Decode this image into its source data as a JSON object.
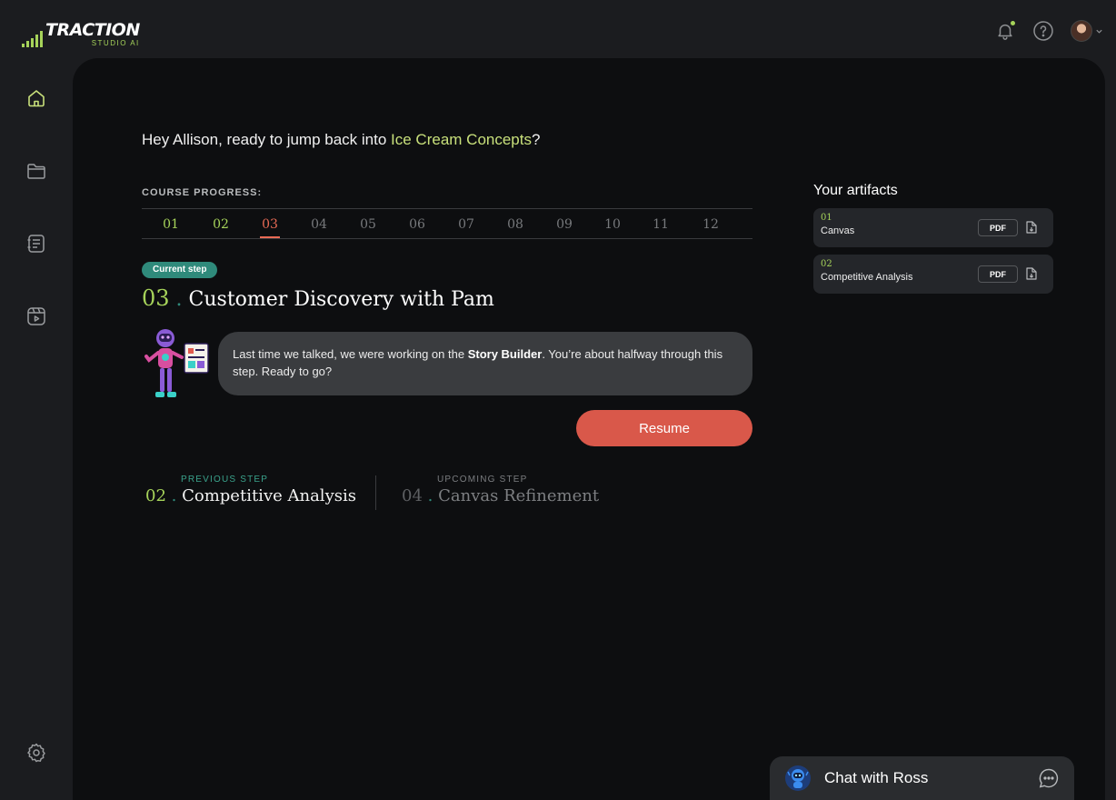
{
  "app": {
    "logo_main": "TRACTION",
    "logo_sub": "STUDIO AI",
    "accent_color": "#a6d35a",
    "brand_red": "#d9584a"
  },
  "topbar": {
    "icons": [
      "bell-icon",
      "help-icon",
      "avatar",
      "chevron-down-icon"
    ]
  },
  "sidebar": {
    "items": [
      "home-icon",
      "folder-icon",
      "notebook-icon",
      "video-icon",
      "settings-icon"
    ]
  },
  "main": {
    "greeting_prefix": "Hey Allison, ready to jump back into ",
    "greeting_project": "Ice Cream Concepts",
    "greeting_suffix": "?",
    "progress_label": "COURSE PROGRESS:",
    "steps": [
      "01",
      "02",
      "03",
      "04",
      "05",
      "06",
      "07",
      "08",
      "09",
      "10",
      "11",
      "12"
    ],
    "current_step_index": 2,
    "badge": "Current step",
    "step_num": "03",
    "step_dot": ".",
    "step_title": "Customer Discovery with Pam",
    "bubble_pre": "Last time we talked, we were working on the ",
    "bubble_bold": "Story Builder",
    "bubble_post": ". You’re about halfway through this step. Ready to go?",
    "resume_label": "Resume",
    "previous": {
      "label": "PREVIOUS STEP",
      "num": "02",
      "title": "Competitive Analysis"
    },
    "upcoming": {
      "label": "UPCOMING STEP",
      "num": "04",
      "title": "Canvas Refinement"
    }
  },
  "artifacts": {
    "title": "Your artifacts",
    "items": [
      {
        "num": "01",
        "name": "Canvas",
        "pdf": "PDF"
      },
      {
        "num": "02",
        "name": "Competitive Analysis",
        "pdf": "PDF"
      }
    ]
  },
  "chat": {
    "label": "Chat with Ross"
  }
}
